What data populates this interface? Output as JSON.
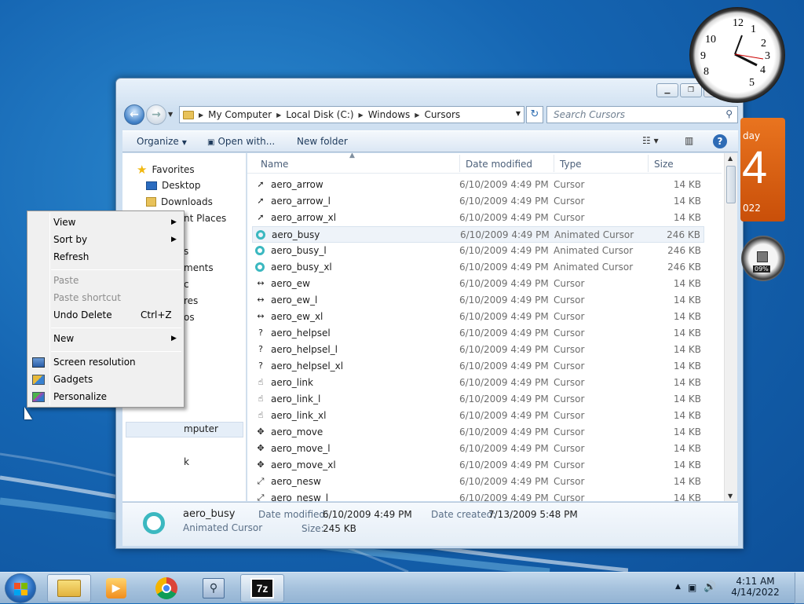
{
  "window": {
    "breadcrumb": [
      "My Computer",
      "Local Disk (C:)",
      "Windows",
      "Cursors"
    ],
    "search_placeholder": "Search Cursors",
    "commands": {
      "organize": "Organize",
      "open_with": "Open with...",
      "new_folder": "New folder"
    }
  },
  "nav_pane": {
    "items": [
      "Favorites",
      "Desktop",
      "Downloads",
      "nt Places",
      "s",
      "ments",
      "c",
      "res",
      "os",
      "mputer",
      "k"
    ]
  },
  "columns": {
    "name": "Name",
    "date": "Date modified",
    "type": "Type",
    "size": "Size"
  },
  "files": [
    {
      "name": "aero_arrow",
      "date": "6/10/2009 4:49 PM",
      "type": "Cursor",
      "size": "14 KB",
      "icon": "arrow-cursor-icon"
    },
    {
      "name": "aero_arrow_l",
      "date": "6/10/2009 4:49 PM",
      "type": "Cursor",
      "size": "14 KB",
      "icon": "arrow-cursor-icon"
    },
    {
      "name": "aero_arrow_xl",
      "date": "6/10/2009 4:49 PM",
      "type": "Cursor",
      "size": "14 KB",
      "icon": "arrow-cursor-icon"
    },
    {
      "name": "aero_busy",
      "date": "6/10/2009 4:49 PM",
      "type": "Animated Cursor",
      "size": "246 KB",
      "icon": "busy-ring-icon",
      "selected": true
    },
    {
      "name": "aero_busy_l",
      "date": "6/10/2009 4:49 PM",
      "type": "Animated Cursor",
      "size": "246 KB",
      "icon": "busy-ring-icon"
    },
    {
      "name": "aero_busy_xl",
      "date": "6/10/2009 4:49 PM",
      "type": "Animated Cursor",
      "size": "246 KB",
      "icon": "busy-ring-icon"
    },
    {
      "name": "aero_ew",
      "date": "6/10/2009 4:49 PM",
      "type": "Cursor",
      "size": "14 KB",
      "icon": "resize-ew-icon"
    },
    {
      "name": "aero_ew_l",
      "date": "6/10/2009 4:49 PM",
      "type": "Cursor",
      "size": "14 KB",
      "icon": "resize-ew-icon"
    },
    {
      "name": "aero_ew_xl",
      "date": "6/10/2009 4:49 PM",
      "type": "Cursor",
      "size": "14 KB",
      "icon": "resize-ew-icon"
    },
    {
      "name": "aero_helpsel",
      "date": "6/10/2009 4:49 PM",
      "type": "Cursor",
      "size": "14 KB",
      "icon": "help-cursor-icon"
    },
    {
      "name": "aero_helpsel_l",
      "date": "6/10/2009 4:49 PM",
      "type": "Cursor",
      "size": "14 KB",
      "icon": "help-cursor-icon"
    },
    {
      "name": "aero_helpsel_xl",
      "date": "6/10/2009 4:49 PM",
      "type": "Cursor",
      "size": "14 KB",
      "icon": "help-cursor-icon"
    },
    {
      "name": "aero_link",
      "date": "6/10/2009 4:49 PM",
      "type": "Cursor",
      "size": "14 KB",
      "icon": "hand-cursor-icon"
    },
    {
      "name": "aero_link_l",
      "date": "6/10/2009 4:49 PM",
      "type": "Cursor",
      "size": "14 KB",
      "icon": "hand-cursor-icon"
    },
    {
      "name": "aero_link_xl",
      "date": "6/10/2009 4:49 PM",
      "type": "Cursor",
      "size": "14 KB",
      "icon": "hand-cursor-icon"
    },
    {
      "name": "aero_move",
      "date": "6/10/2009 4:49 PM",
      "type": "Cursor",
      "size": "14 KB",
      "icon": "move-cursor-icon"
    },
    {
      "name": "aero_move_l",
      "date": "6/10/2009 4:49 PM",
      "type": "Cursor",
      "size": "14 KB",
      "icon": "move-cursor-icon"
    },
    {
      "name": "aero_move_xl",
      "date": "6/10/2009 4:49 PM",
      "type": "Cursor",
      "size": "14 KB",
      "icon": "move-cursor-icon"
    },
    {
      "name": "aero_nesw",
      "date": "6/10/2009 4:49 PM",
      "type": "Cursor",
      "size": "14 KB",
      "icon": "resize-nesw-icon"
    },
    {
      "name": "aero_nesw_l",
      "date": "6/10/2009 4:49 PM",
      "type": "Cursor",
      "size": "14 KB",
      "icon": "resize-nesw-icon"
    }
  ],
  "details": {
    "name": "aero_busy",
    "type": "Animated Cursor",
    "date_modified_label": "Date modified:",
    "date_modified": "6/10/2009 4:49 PM",
    "date_created_label": "Date created:",
    "date_created": "7/13/2009 5:48 PM",
    "size_label": "Size:",
    "size": "245 KB"
  },
  "context_menu": {
    "view": "View",
    "sort_by": "Sort by",
    "refresh": "Refresh",
    "paste": "Paste",
    "paste_shortcut": "Paste shortcut",
    "undo_delete": "Undo Delete",
    "undo_shortcut": "Ctrl+Z",
    "new": "New",
    "screen_resolution": "Screen resolution",
    "gadgets": "Gadgets",
    "personalize": "Personalize"
  },
  "gadgets": {
    "calendar_day": "day",
    "calendar_date": "4",
    "calendar_year": "022",
    "meter_percent": "09%",
    "clock_numbers": [
      "12",
      "1",
      "2",
      "3",
      "4",
      "5",
      "10",
      "9",
      "8"
    ]
  },
  "taskbar": {
    "time": "4:11 AM",
    "date": "4/14/2022",
    "apps": [
      "explorer-icon",
      "media-player-icon",
      "chrome-icon",
      "magnifier-icon",
      "7zip-icon"
    ],
    "sevenzip_label": "7z"
  }
}
